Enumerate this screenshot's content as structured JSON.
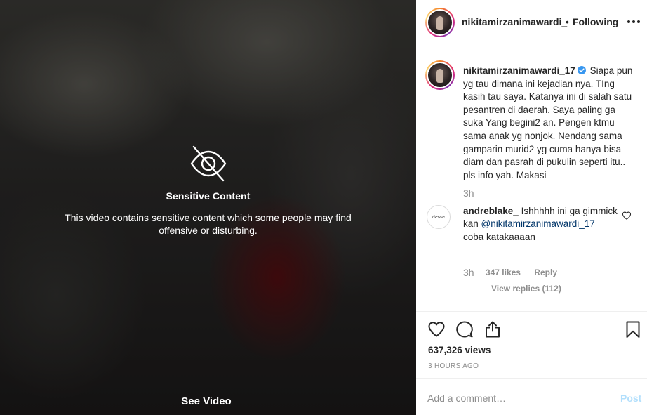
{
  "media": {
    "sensitive_icon": "eye-slash-icon",
    "sensitive_title": "Sensitive Content",
    "sensitive_description": "This video contains sensitive content which some people may find offensive or disturbing.",
    "see_video_label": "See Video"
  },
  "header": {
    "username": "nikitamirzanimawardi_",
    "separator": "•",
    "follow_status": "Following",
    "more_icon": "more-options-icon"
  },
  "caption": {
    "username": "nikitamirzanimawardi_17",
    "verified_icon": "verified-badge-icon",
    "text": "Siapa pun yg tau dimana ini kejadian nya. TIng kasih tau saya. Katanya ini di salah satu pesantren di daerah. Saya paling ga suka Yang begini2 an. Pengen ktmu sama anak yg nonjok. Nendang sama gamparin murid2 yg cuma hanya bisa diam dan pasrah di pukulin seperti itu.. pls info yah. Makasi",
    "time": "3h"
  },
  "comment": {
    "username": "andreblake_",
    "text_before": "Ishhhhh ini ga gimmick kan",
    "mention": "@nikitamirzanimawardi_17",
    "text_after": "coba katakaaaan",
    "time": "3h",
    "likes": "347 likes",
    "reply_label": "Reply",
    "view_replies": "View replies (112)",
    "like_icon": "heart-outline-icon"
  },
  "actions": {
    "icons": [
      "heart-icon",
      "comment-icon",
      "share-icon",
      "bookmark-icon"
    ],
    "views": "637,326 views",
    "time_ago": "3 HOURS AGO"
  },
  "add_comment": {
    "placeholder": "Add a comment…",
    "post_label": "Post"
  },
  "colors": {
    "text": "#262626",
    "secondary": "#8e8e8e",
    "mention": "#003569",
    "post_disabled": "#b2dffc",
    "verified": "#3897f0",
    "divider": "#efefef"
  }
}
